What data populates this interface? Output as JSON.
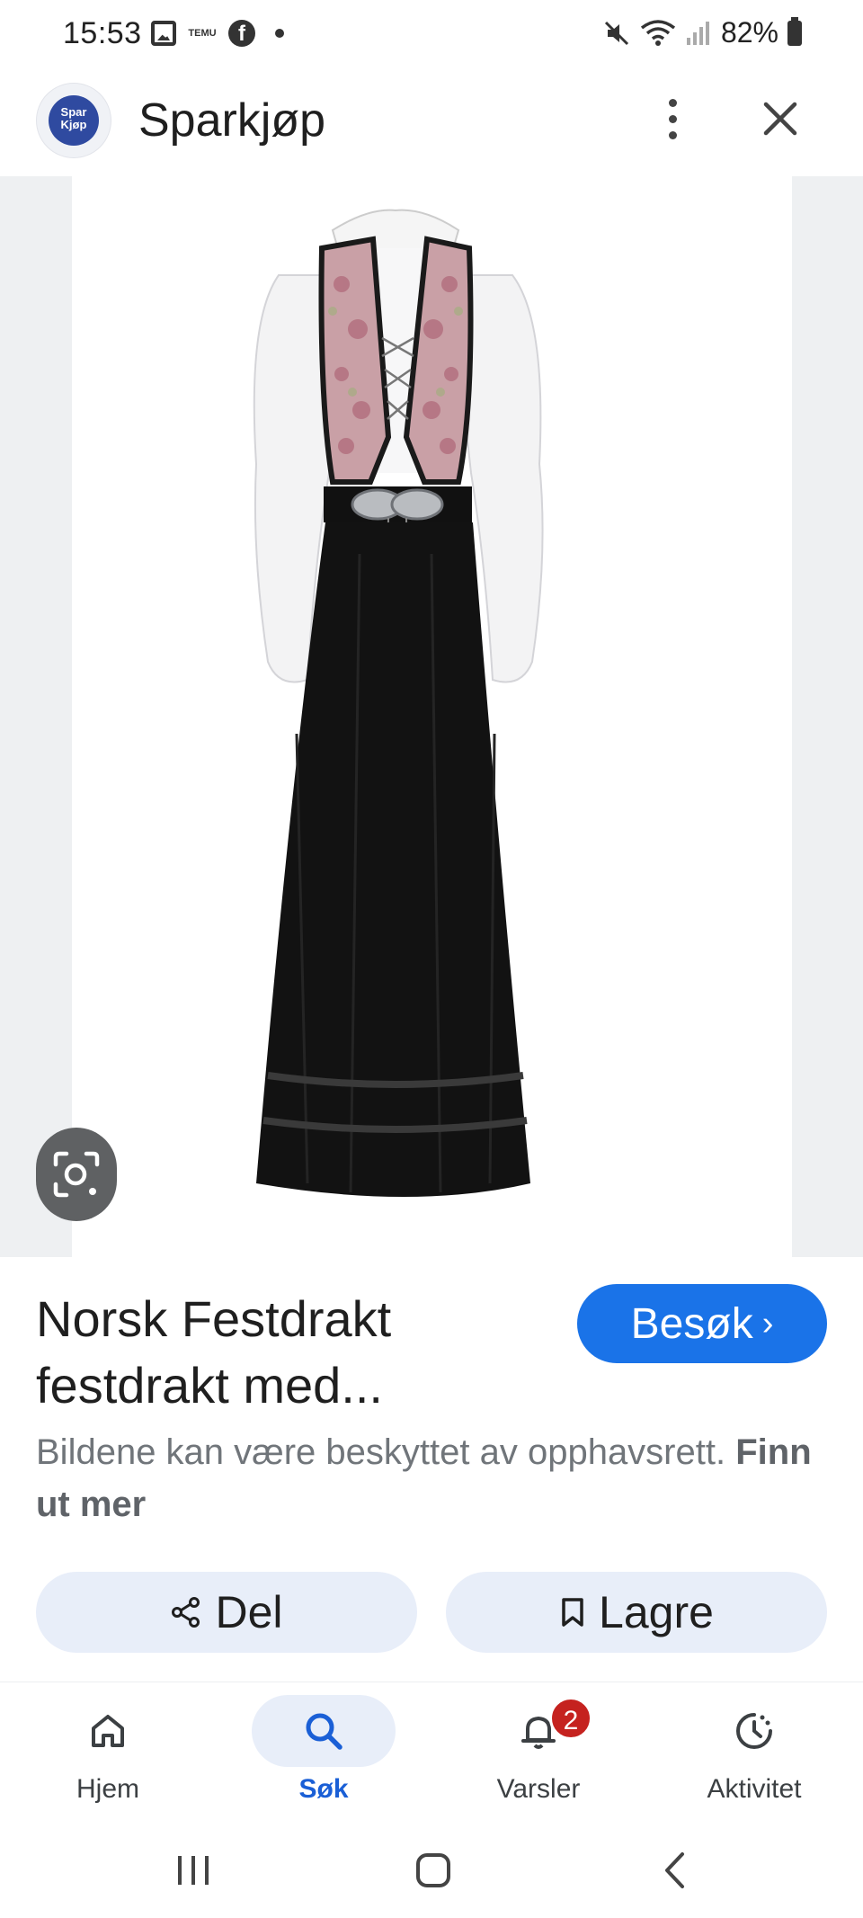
{
  "status_bar": {
    "time": "15:53",
    "notification_temu": "TEMU",
    "battery": "82%"
  },
  "header": {
    "logo_text": "Spar Kjøp",
    "site_name": "Sparkjøp"
  },
  "result": {
    "title_line1": "Norsk Festdrakt",
    "title_line2": "festdrakt med...",
    "visit_label": "Besøk",
    "notice_text": "Bildene kan være beskyttet av opphavsrett.",
    "notice_link": "Finn ut mer"
  },
  "actions": {
    "share_label": "Del",
    "save_label": "Lagre"
  },
  "bottom_nav": {
    "items": [
      {
        "label": "Hjem",
        "icon": "home-icon"
      },
      {
        "label": "Søk",
        "icon": "search-icon"
      },
      {
        "label": "Varsler",
        "icon": "bell-icon",
        "badge": "2"
      },
      {
        "label": "Aktivitet",
        "icon": "activity-icon"
      }
    ],
    "active_index": 1
  },
  "colors": {
    "accent": "#1a73e8",
    "chip_bg": "#e8eef9",
    "badge": "#c5221f"
  }
}
